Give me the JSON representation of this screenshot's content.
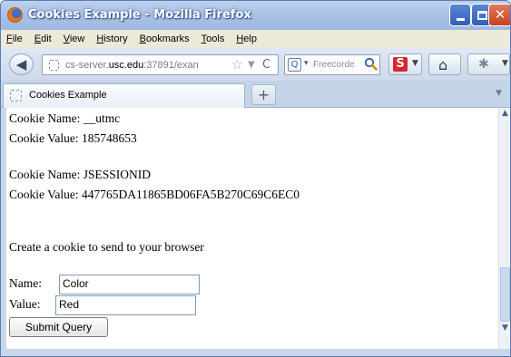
{
  "window": {
    "title": "Cookies Example",
    "title_full": "Cookies Example - Mozilla Firefox",
    "accent": "#2f5fb8"
  },
  "menu": [
    "File",
    "Edit",
    "View",
    "History",
    "Bookmarks",
    "Tools",
    "Help"
  ],
  "nav": {
    "url_host": "cs-server.usc.edu",
    "url_rest": ":37891/exan",
    "search_placeholder": "Freecorde"
  },
  "tabs": [
    {
      "label": "Cookies Example",
      "active": true
    }
  ],
  "page": {
    "cookies": [
      {
        "name_line": "Cookie Name: __utmc",
        "value_line": "Cookie Value: 185748653"
      },
      {
        "name_line": "Cookie Name: JSESSIONID",
        "value_line": "Cookie Value: 447765DA11865BD06FA5B270C69C6EC0"
      }
    ],
    "create_text": "Create a cookie to send to your browser",
    "form": {
      "name_label": "Name:",
      "name_value": "Color",
      "value_label": "Value:",
      "value_value": "Red",
      "submit_label": "Submit Query"
    }
  }
}
